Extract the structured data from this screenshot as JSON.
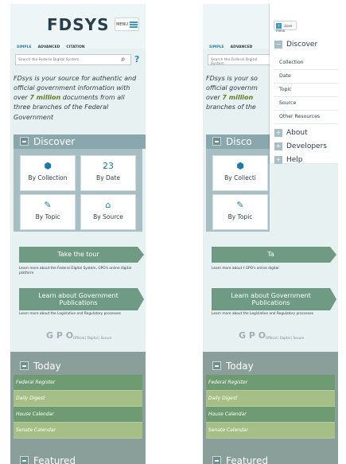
{
  "screen_a": {
    "logo": "FDSYS",
    "menu_label": "MENU",
    "tabs": [
      "SIMPLE",
      "ADVANCED",
      "CITATION"
    ],
    "search_placeholder": "Search the Federal Digital System",
    "intro": {
      "before": "FDsys is your source for authentic and official government information with over ",
      "highlight": "7 million",
      "after": " documents from all three branches of the Federal Government"
    },
    "discover_title": "Discover",
    "cards": [
      {
        "label": "By Collection",
        "icon": "package-icon"
      },
      {
        "label": "By Date",
        "icon": "calendar-icon"
      },
      {
        "label": "By Topic",
        "icon": "wrench-icon"
      },
      {
        "label": "By Source",
        "icon": "building-icon"
      }
    ],
    "calendar_day": "23",
    "tour_label": "Take the tour",
    "tour_desc": "Learn more about the Federal Digital System, GPO's online digital platform",
    "learn_label": "Learn about\nGovernment Publications",
    "learn_desc": "Learn more about the Legislative and Regulatory processes",
    "gpo_logo": "G P O",
    "gpo_tagline": "Official | Digital | Secure",
    "today_title": "Today",
    "today_items": [
      "Federal Register",
      "Daily Digest",
      "House Calendar",
      "Senate Calendar"
    ],
    "featured_title": "Featured"
  },
  "screen_b": {
    "back_label": "close menu",
    "sections": {
      "discover": "Discover",
      "about": "About",
      "developers": "Developers",
      "help": "Help"
    },
    "discover_items": [
      "Collection",
      "Date",
      "Topic",
      "Source",
      "Other Resources"
    ],
    "intro_visible": {
      "before": "FDsys is your so",
      "line2": "official governm",
      "line3": "over ",
      "highlight": "7 million",
      "line4": "branches of the"
    },
    "discover_short": "Disco",
    "card_labels": [
      "By Collecti",
      "By Topic"
    ],
    "tour_short": "Ta",
    "tour_desc_short": "Learn more about t\nGPO's online digital",
    "learn_short": "Learn about\nGovernment Publications",
    "learn_desc_short": "Learn more about the Legislative and Regulatory processes",
    "today_title": "Today",
    "today_items": [
      "Federal Register",
      "Daily Digest",
      "House Calendar",
      "Senate Calendar"
    ],
    "featured_title": "Featured"
  }
}
